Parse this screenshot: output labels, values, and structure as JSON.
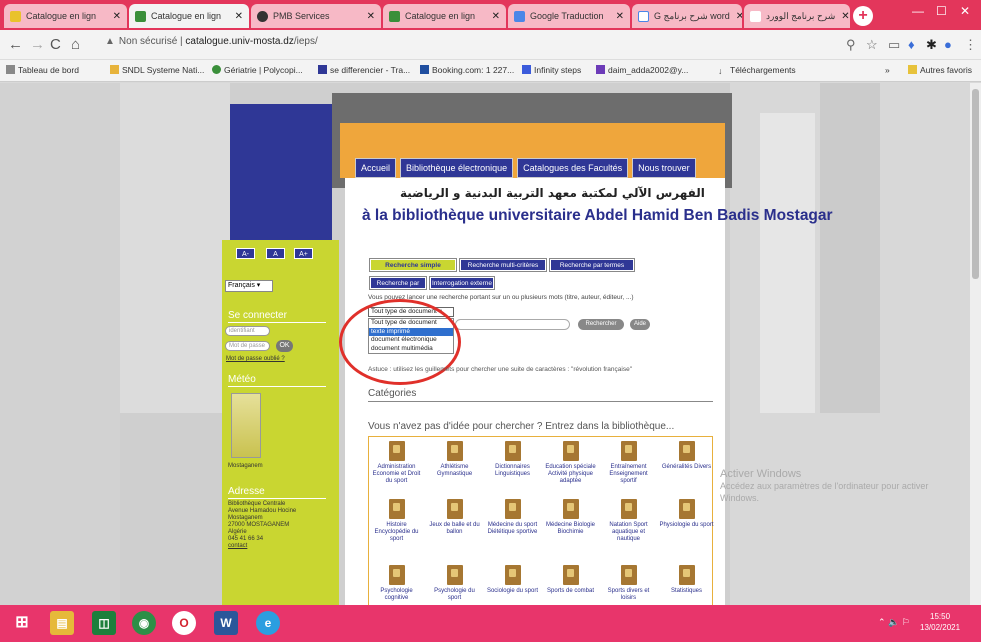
{
  "tabs": [
    {
      "label": "Catalogue en lign",
      "active": false
    },
    {
      "label": "Catalogue en lign",
      "active": true
    },
    {
      "label": "PMB Services",
      "active": false
    },
    {
      "label": "Catalogue en lign",
      "active": false
    },
    {
      "label": "Google Traduction",
      "active": false
    },
    {
      "label": "G شرح برنامج word",
      "active": false
    },
    {
      "label": "شرح برنامج الوورد",
      "active": false
    }
  ],
  "browser": {
    "security_label": "Non sécurisé",
    "url_host": "catalogue.univ-mosta.dz",
    "url_path": "/ieps/"
  },
  "bookmarks": [
    "Tableau de bord",
    "SNDL Systeme Nati...",
    "Gériatrie | Polycopi...",
    "se differencier - Tra...",
    "Booking.com: 1 227...",
    "Infinity steps",
    "daim_adda2002@y...",
    "Téléchargements"
  ],
  "bookmarks_other": "Autres favoris",
  "site": {
    "menu": [
      "Accueil",
      "Bibliothèque électronique",
      "Catalogues des Facultés",
      "Nous trouver"
    ],
    "arabic_title": "الفهرس الآلي لمكتبة معهد التربية البدنية و الرياضية",
    "welcome": "à la bibliothèque universitaire Abdel Hamid Ben Badis Mostagar",
    "font_buttons": [
      "A-",
      "A",
      "A+"
    ],
    "language": "Français",
    "login_heading": "Se connecter",
    "login_placeholder": "identifiant",
    "password_placeholder": "Mot de passe",
    "ok_label": "OK",
    "forgot": "Mot de passe oublié ?",
    "meteo_heading": "Météo",
    "meteo_text": "Mostaganem",
    "address_heading": "Adresse",
    "address_lines": [
      "Bibliothèque Centrale",
      "Avenue Hamadou Hocine",
      "Mostaganem",
      "27000 MOSTAGANEM",
      "Algérie",
      "045 41 66 34",
      "contact"
    ],
    "search_tabs": [
      "Recherche simple",
      "Recherche multi-critères",
      "Recherche par termes",
      "Recherche par tags",
      "Interrogation externe"
    ],
    "help_text": "Vous pouvez lancer une recherche portant sur un ou plusieurs mots (titre, auteur, éditeur, ...)",
    "type_select_value": "Tout type de document",
    "type_options": [
      "Tout type de document",
      "texte imprimé",
      "document électronique",
      "document multimédia"
    ],
    "search_button": "Rechercher",
    "help_button": "Aide",
    "hint": "Astuce : utilisez les guillemets pour chercher une suite de caractères : \"révolution française\"",
    "categories_heading": "Catégories",
    "categories_sub": "Vous n'avez pas d'idée pour chercher ? Entrez dans la bibliothèque...",
    "categories_row1": [
      "Administration Economie et Droit du sport",
      "Athlétisme Gymnastique",
      "Dictionnaires Linguistiques",
      "Education spéciale Activité physique adaptée",
      "Entraînement Enseignement sportif",
      "Généralités Divers"
    ],
    "categories_row2": [
      "Histoire Encyclopédie du sport",
      "Jeux de balle et du ballon",
      "Médecine du sport Diététique sportive",
      "Médecine Biologie Biochimie",
      "Natation Sport aquatique et nautique",
      "Physiologie du sport"
    ],
    "categories_row3": [
      "Psychologie cognitive",
      "Psychologie du sport",
      "Sociologie du sport",
      "Sports de combat",
      "Sports divers et loisirs",
      "Statistiques"
    ],
    "activate_windows": "Activer Windows",
    "activate_sub": "Accédez aux paramètres de l'ordinateur pour activer Windows."
  },
  "taskbar": {
    "time": "15:50",
    "date": "13/02/2021"
  },
  "colors": {
    "tabbar": "#e3365b",
    "site_blue": "#2f3796",
    "sidebar_yellow": "#c9d631",
    "highlight_circle": "#e0302a"
  }
}
